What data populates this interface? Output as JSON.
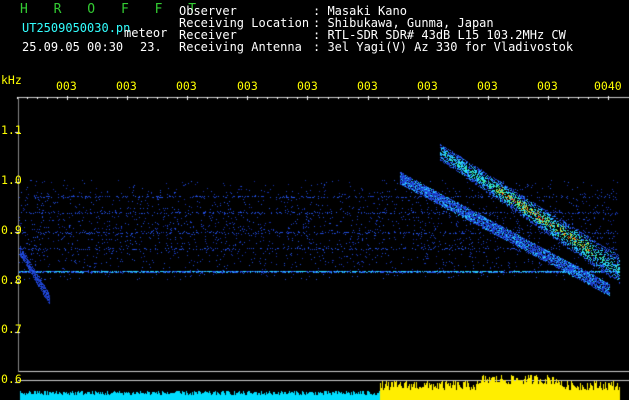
{
  "header": {
    "logo": "H R O F F T",
    "filename": "UT2509050030.pn",
    "meteor": "meteor",
    "datetime": "25.09.05 00:30",
    "count": "23.",
    "labels": [
      "Observer",
      "Receiving Location",
      "Receiver",
      "Receiving Antenna"
    ],
    "values": [
      ": Masaki Kano",
      ": Shibukawa, Gunma, Japan",
      ": RTL-SDR SDR# 43dB L15 103.2MHz CW",
      ": 3el Yagi(V) Az 330 for Vladivostok"
    ]
  },
  "axes": {
    "y_unit": "kHz",
    "y_labels": [
      "1.1",
      "1.0",
      "0.9",
      "0.8",
      "0.7",
      "0.6"
    ],
    "x_labels": [
      "003",
      "003",
      "003",
      "003",
      "003",
      "003",
      "003",
      "003",
      "003",
      "0040"
    ]
  },
  "colors": {
    "header_white": "#ffffff",
    "logo_green": "#33cc33",
    "filename_cyan": "#33ffff",
    "axis_yellow": "#ffff00",
    "signal_blue": "#2244ff",
    "level_cyan": "#00ddff",
    "level_yellow": "#ffee00"
  }
}
